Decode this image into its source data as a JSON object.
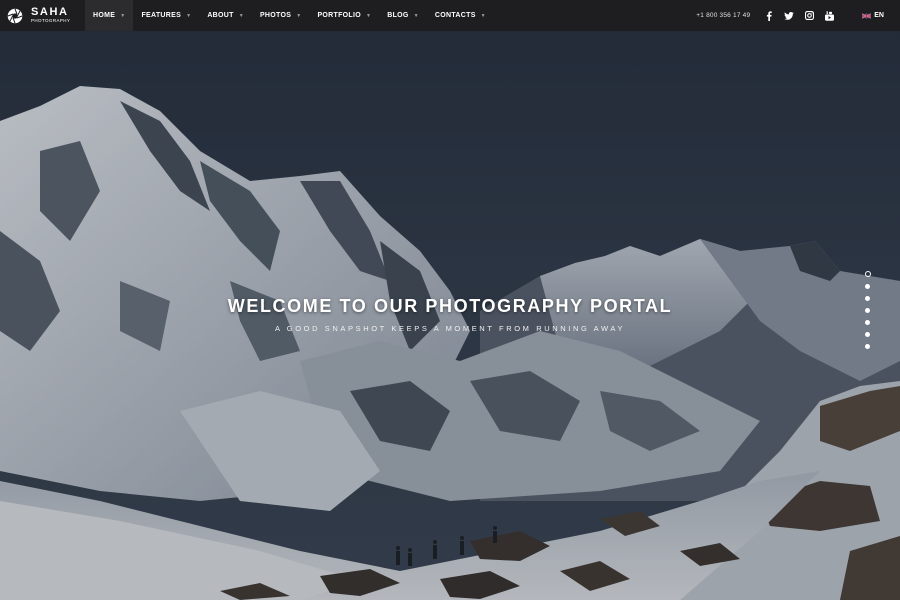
{
  "logo": {
    "title": "SAHA",
    "subtitle": "PHOTOGRAPHY"
  },
  "nav": [
    {
      "label": "HOME",
      "active": true
    },
    {
      "label": "FEATURES"
    },
    {
      "label": "ABOUT"
    },
    {
      "label": "PHOTOS"
    },
    {
      "label": "PORTFOLIO"
    },
    {
      "label": "BLOG"
    },
    {
      "label": "CONTACTS"
    }
  ],
  "phone": "+1 800 356 17 49",
  "social": [
    "facebook-icon",
    "twitter-icon",
    "instagram-icon",
    "youtube-icon"
  ],
  "language": {
    "code": "EN",
    "flag": "uk-flag-icon"
  },
  "hero": {
    "title": "WELCOME TO OUR PHOTOGRAPHY PORTAL",
    "subtitle": "A GOOD SNAPSHOT KEEPS A MOMENT FROM RUNNING AWAY"
  },
  "slider": {
    "count": 7,
    "active_index": 0
  },
  "colors": {
    "topbar": "#1e1e20",
    "active_nav": "#2c2c2e",
    "sky": "#2b3645"
  }
}
